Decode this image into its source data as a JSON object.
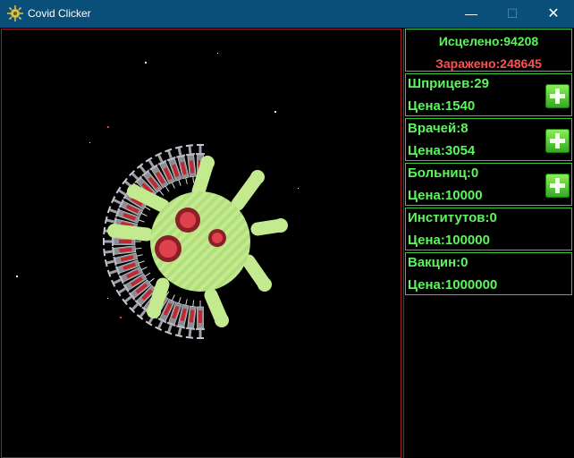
{
  "window": {
    "title": "Covid Clicker",
    "minimize_glyph": "—",
    "maximize_glyph": "☐",
    "close_glyph": "✕"
  },
  "colors": {
    "title_bar": "#0a4f7a",
    "panel_border_green": "#39c939",
    "panel_border_red": "#a01c1c",
    "text_green": "#5df55d",
    "text_red": "#ff5050",
    "virus_body": "#bde68a",
    "virus_spot": "#e0424d"
  },
  "stats": {
    "healed": "Исцелено:94208",
    "infected": "Заражено:248645"
  },
  "shop": [
    {
      "name": "Шприцев:29",
      "price": "Цена:1540",
      "buy_icon": "plus-icon"
    },
    {
      "name": "Врачей:8",
      "price": "Цена:3054",
      "buy_icon": "plus-icon"
    },
    {
      "name": "Больниц:0",
      "price": "Цена:10000",
      "buy_icon": "plus-icon"
    },
    {
      "name": "Институтов:0",
      "price": "Цена:100000"
    },
    {
      "name": "Вакцин:0",
      "price": "Цена:1000000"
    }
  ],
  "game": {
    "syringe_count": 29,
    "virus_icon": "virus-icon",
    "syringe_icon": "syringe-icon"
  }
}
